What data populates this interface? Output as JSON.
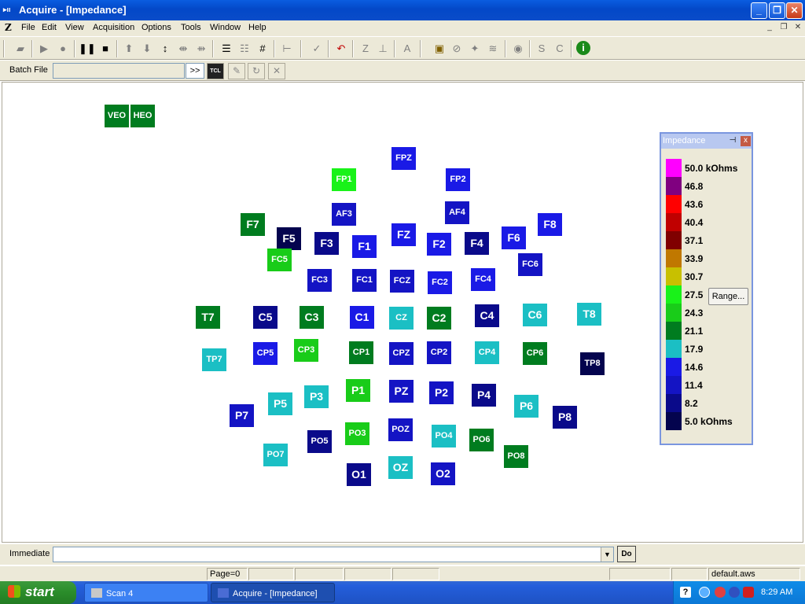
{
  "window": {
    "title": "Acquire - [Impedance]",
    "minimize_glyph": "_",
    "restore_glyph": "❐",
    "close_glyph": "✕"
  },
  "menu": {
    "logo": "Z",
    "items": [
      "File",
      "Edit",
      "View",
      "Acquisition",
      "Options",
      "Tools",
      "Window",
      "Help"
    ]
  },
  "toolbar": {
    "icons": [
      "open-folder-icon",
      "play-icon",
      "record-icon",
      "pause-icon",
      "stop-icon",
      "arrow-up-icon",
      "arrow-down-icon",
      "expand-vertical-icon",
      "compress-icon",
      "shrink-icon",
      "list-sort-icon",
      "list-icon",
      "grid-icon",
      "baseline-icon",
      "checkmark-icon",
      "undo-arrow-icon",
      "z-icon",
      "trigger-icon",
      "font-icon",
      "note-icon",
      "erase-icon",
      "wand-icon",
      "waves-icon",
      "eye-icon",
      "s-icon",
      "c-icon",
      "info-icon"
    ]
  },
  "batch": {
    "label": "Batch File",
    "value": "",
    "go_label": ">>",
    "tcl_label": "TCL"
  },
  "electrodes": [
    {
      "label": "VEO",
      "color": "#007c1f"
    },
    {
      "label": "HEO",
      "color": "#007c1f"
    },
    {
      "label": "FPZ",
      "color": "#1a1ae6"
    },
    {
      "label": "FP1",
      "color": "#19f219"
    },
    {
      "label": "FP2",
      "color": "#1a1ae6"
    },
    {
      "label": "AF3",
      "color": "#1414c4"
    },
    {
      "label": "AF4",
      "color": "#1414c4"
    },
    {
      "label": "F7",
      "color": "#007c1f"
    },
    {
      "label": "F5",
      "color": "#04044e"
    },
    {
      "label": "F3",
      "color": "#0a0a8a"
    },
    {
      "label": "F1",
      "color": "#1a1ae6"
    },
    {
      "label": "FZ",
      "color": "#1a1ae6"
    },
    {
      "label": "F2",
      "color": "#1a1ae6"
    },
    {
      "label": "F4",
      "color": "#0a0a8a"
    },
    {
      "label": "F6",
      "color": "#1a1ae6"
    },
    {
      "label": "F8",
      "color": "#1a1ae6"
    },
    {
      "label": "FC5",
      "color": "#19cc19"
    },
    {
      "label": "FC3",
      "color": "#1414c4"
    },
    {
      "label": "FC1",
      "color": "#1414c4"
    },
    {
      "label": "FCZ",
      "color": "#1414c4"
    },
    {
      "label": "FC2",
      "color": "#1a1ae6"
    },
    {
      "label": "FC4",
      "color": "#1a1ae6"
    },
    {
      "label": "FC6",
      "color": "#1414c4"
    },
    {
      "label": "T7",
      "color": "#007c1f"
    },
    {
      "label": "C5",
      "color": "#0a0a8a"
    },
    {
      "label": "C3",
      "color": "#007c1f"
    },
    {
      "label": "C1",
      "color": "#1a1ae6"
    },
    {
      "label": "CZ",
      "color": "#1bbfc4"
    },
    {
      "label": "C2",
      "color": "#007c1f"
    },
    {
      "label": "C4",
      "color": "#0a0a8a"
    },
    {
      "label": "C6",
      "color": "#1bbfc4"
    },
    {
      "label": "T8",
      "color": "#1bbfc4"
    },
    {
      "label": "TP7",
      "color": "#1bbfc4"
    },
    {
      "label": "CP5",
      "color": "#1a1ae6"
    },
    {
      "label": "CP3",
      "color": "#19cc19"
    },
    {
      "label": "CP1",
      "color": "#007c1f"
    },
    {
      "label": "CPZ",
      "color": "#1414c4"
    },
    {
      "label": "CP2",
      "color": "#1414c4"
    },
    {
      "label": "CP4",
      "color": "#1bbfc4"
    },
    {
      "label": "CP6",
      "color": "#007c1f"
    },
    {
      "label": "TP8",
      "color": "#04044e"
    },
    {
      "label": "P7",
      "color": "#1414c4"
    },
    {
      "label": "P5",
      "color": "#1bbfc4"
    },
    {
      "label": "P3",
      "color": "#1bbfc4"
    },
    {
      "label": "P1",
      "color": "#19cc19"
    },
    {
      "label": "PZ",
      "color": "#1414c4"
    },
    {
      "label": "P2",
      "color": "#1414c4"
    },
    {
      "label": "P4",
      "color": "#0a0a8a"
    },
    {
      "label": "P6",
      "color": "#1bbfc4"
    },
    {
      "label": "P8",
      "color": "#0a0a8a"
    },
    {
      "label": "PO7",
      "color": "#1bbfc4"
    },
    {
      "label": "PO5",
      "color": "#0a0a8a"
    },
    {
      "label": "PO3",
      "color": "#19cc19"
    },
    {
      "label": "POZ",
      "color": "#1414c4"
    },
    {
      "label": "PO4",
      "color": "#1bbfc4"
    },
    {
      "label": "PO6",
      "color": "#007c1f"
    },
    {
      "label": "PO8",
      "color": "#007c1f"
    },
    {
      "label": "O1",
      "color": "#0a0a8a"
    },
    {
      "label": "OZ",
      "color": "#1bbfc4"
    },
    {
      "label": "O2",
      "color": "#1414c4"
    }
  ],
  "legend": {
    "title": "Impedance",
    "pin_glyph": "⊣",
    "close_glyph": "x",
    "range_label": "Range...",
    "scale": [
      {
        "label": "50.0 kOhms",
        "color": "#ff00ff"
      },
      {
        "label": "46.8",
        "color": "#800080"
      },
      {
        "label": "43.6",
        "color": "#ff0000"
      },
      {
        "label": "40.4",
        "color": "#c00000"
      },
      {
        "label": "37.1",
        "color": "#800000"
      },
      {
        "label": "33.9",
        "color": "#c07800"
      },
      {
        "label": "30.7",
        "color": "#c8c000"
      },
      {
        "label": "27.5",
        "color": "#19f219"
      },
      {
        "label": "24.3",
        "color": "#19cc19"
      },
      {
        "label": "21.1",
        "color": "#007c1f"
      },
      {
        "label": "17.9",
        "color": "#1bbfc4"
      },
      {
        "label": "14.6",
        "color": "#1a1ae6"
      },
      {
        "label": "11.4",
        "color": "#1414c4"
      },
      {
        "label": "8.2",
        "color": "#0a0a8a"
      },
      {
        "label": "5.0 kOhms",
        "color": "#04044e"
      }
    ]
  },
  "immediate": {
    "label": "Immediate",
    "value": "",
    "do_label": "Do"
  },
  "status": {
    "page": "Page=0",
    "file": "default.aws"
  },
  "taskbar": {
    "start_label": "start",
    "tasks": [
      {
        "label": "Scan 4"
      },
      {
        "label": "Acquire - [Impedance]"
      }
    ],
    "clock": "8:29 AM"
  }
}
